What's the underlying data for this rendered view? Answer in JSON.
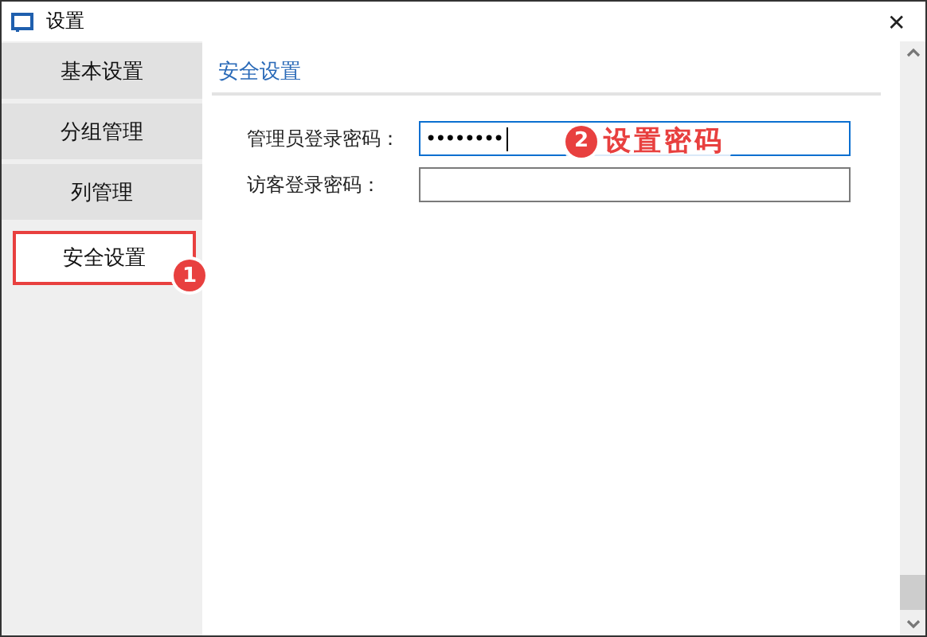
{
  "window": {
    "title": "设置",
    "close": "✕"
  },
  "sidebar": {
    "items": [
      {
        "label": "基本设置",
        "selected": false
      },
      {
        "label": "分组管理",
        "selected": false
      },
      {
        "label": "列管理",
        "selected": false
      },
      {
        "label": "安全设置",
        "selected": true
      }
    ]
  },
  "section": {
    "title": "安全设置"
  },
  "fields": [
    {
      "label": "管理员登录密码：",
      "value": "••••••••",
      "focused": true
    },
    {
      "label": "访客登录密码：",
      "focused": false
    }
  ],
  "annotations": [
    {
      "number": "1"
    },
    {
      "number": "2",
      "text": "设置密码"
    }
  ]
}
